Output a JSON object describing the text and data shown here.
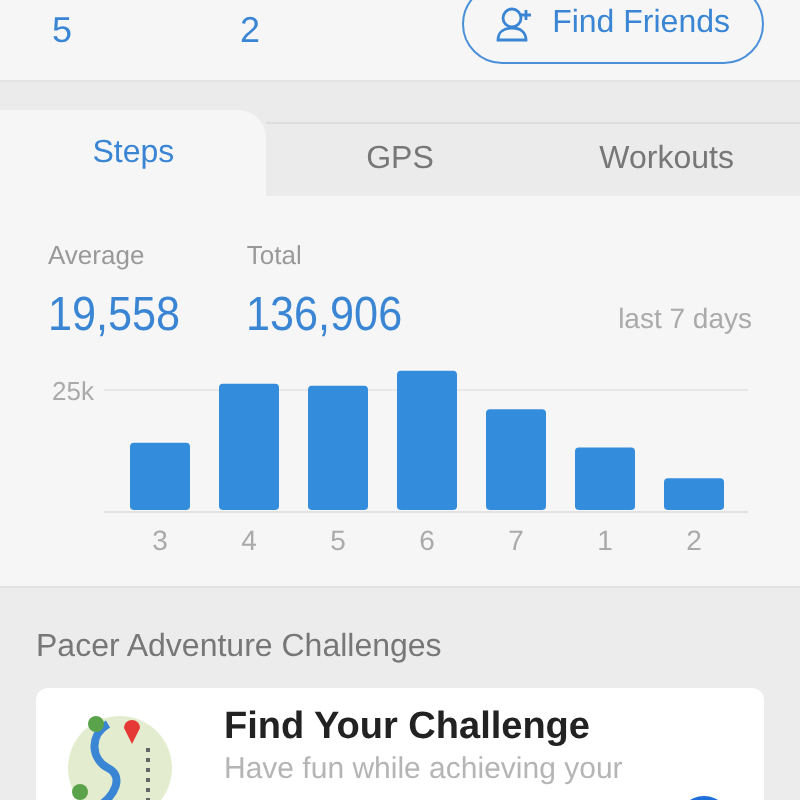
{
  "stats": [
    {
      "value": "5"
    },
    {
      "value": "2"
    }
  ],
  "find_friends_button": {
    "label": "Find Friends"
  },
  "tabs": [
    {
      "label": "Steps",
      "selected": true
    },
    {
      "label": "GPS",
      "selected": false
    },
    {
      "label": "Workouts",
      "selected": false
    }
  ],
  "summary": [
    {
      "label": "Average",
      "value": "19,558"
    },
    {
      "label": "Total",
      "value": "136,906"
    }
  ],
  "period": "last 7 days",
  "chart_data": {
    "type": "bar",
    "categories": [
      "3",
      "4",
      "5",
      "6",
      "7",
      "1",
      "2"
    ],
    "values": [
      14000,
      26300,
      25900,
      29000,
      21000,
      13000,
      6600
    ],
    "ylim": [
      0,
      30000
    ],
    "yticks": [
      {
        "value": 25000,
        "label": "25k"
      }
    ]
  },
  "challenges": {
    "heading": "Pacer Adventure Challenges",
    "card": {
      "title": "Find Your Challenge",
      "subtitle": "Have fun while achieving your"
    }
  }
}
